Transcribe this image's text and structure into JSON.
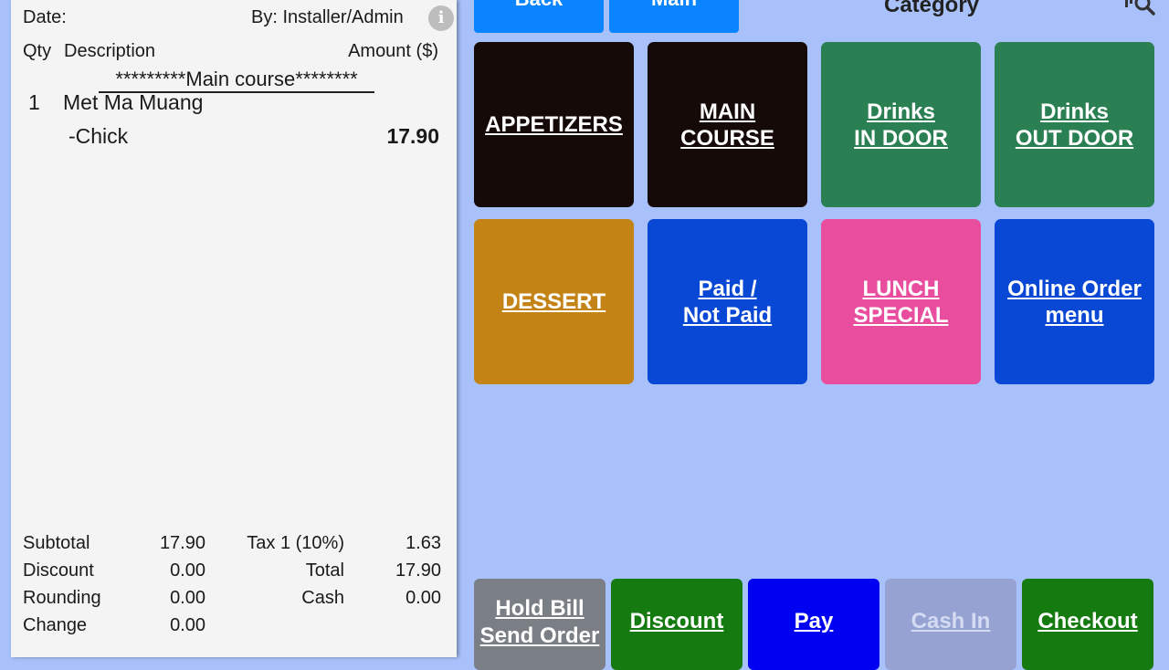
{
  "receipt": {
    "date_label": "Date:",
    "by_label": "By: Installer/Admin",
    "info_glyph": "i",
    "columns": {
      "qty": "Qty",
      "description": "Description",
      "amount": "Amount ($)"
    },
    "section_heading": "*********Main course********",
    "items": [
      {
        "qty": "1",
        "name": "Met Ma Muang",
        "modifier": "-Chick",
        "amount": "17.90"
      }
    ],
    "totals": {
      "subtotal_label": "Subtotal",
      "subtotal": "17.90",
      "discount_label": "Discount",
      "discount": "0.00",
      "rounding_label": "Rounding",
      "rounding": "0.00",
      "change_label": "Change",
      "change": "0.00",
      "tax_label": "Tax 1 (10%)",
      "tax": "1.63",
      "total_label": "Total",
      "total": "17.90",
      "cash_label": "Cash",
      "cash": "0.00"
    }
  },
  "nav": {
    "back_label": "Back",
    "main_label": "Main",
    "category_title": "Category"
  },
  "categories": [
    {
      "label": "APPETIZERS",
      "color": "#150a07"
    },
    {
      "label": "MAIN\nCOURSE",
      "color": "#150a07"
    },
    {
      "label": "Drinks\nIN DOOR",
      "color": "#2a7f53"
    },
    {
      "label": "Drinks\nOUT DOOR",
      "color": "#2a7f53"
    },
    {
      "label": "DESSERT",
      "color": "#c48315"
    },
    {
      "label": "Paid /\nNot Paid",
      "color": "#0848d4"
    },
    {
      "label": "LUNCH\nSPECIAL",
      "color": "#e94d9e"
    },
    {
      "label": "Online Order\nmenu",
      "color": "#0848d4"
    }
  ],
  "actions": [
    {
      "label": "Hold Bill\nSend Order",
      "color": "#7a7e85"
    },
    {
      "label": "Discount",
      "color": "#157a10"
    },
    {
      "label": "Pay",
      "color": "#0101f2"
    },
    {
      "label": "Cash In",
      "color": "#96a3d2",
      "text_color": "#d4dbf2"
    },
    {
      "label": "Checkout",
      "color": "#157a10"
    }
  ]
}
